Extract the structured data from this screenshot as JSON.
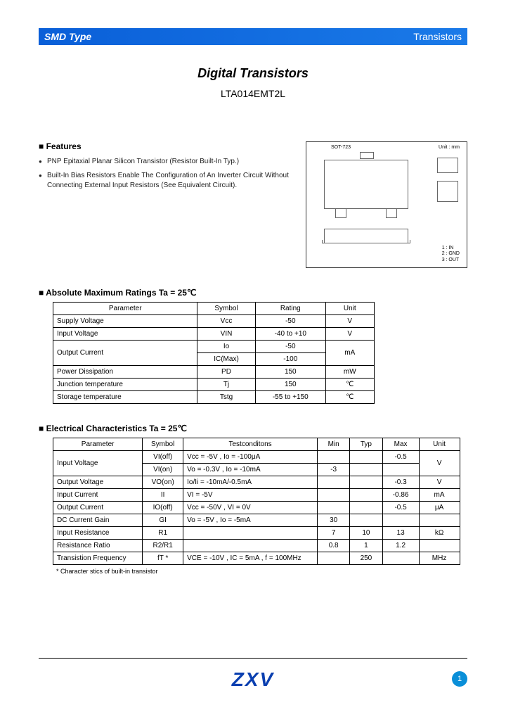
{
  "header": {
    "left": "SMD Type",
    "right": "Transistors"
  },
  "title": "Digital Transistors",
  "part_number": "LTA014EMT2L",
  "features": {
    "heading": "Features",
    "items": [
      "PNP Epitaxial Planar Silicon Transistor (Resistor Built-In Typ.)",
      "Built-In Bias Resistors Enable The Configuration of An Inverter Circuit Without Connecting External Input Resistors (See Equivalent Circuit)."
    ]
  },
  "diagram": {
    "pkg_label": "SOT-723",
    "unit_label": "Unit : mm",
    "pins": [
      "1 : IN",
      "2 : GND",
      "3 : OUT"
    ]
  },
  "abs_max": {
    "heading": "Absolute Maximum Ratings Ta = 25℃",
    "headers": [
      "Parameter",
      "Symbol",
      "Rating",
      "Unit"
    ],
    "rows": [
      {
        "p": "Supply Voltage",
        "s": "Vcc",
        "r": "-50",
        "u": "V"
      },
      {
        "p": "Input Voltage",
        "s": "VIN",
        "r": "-40 to +10",
        "u": "V"
      },
      {
        "p": "Output Current",
        "s": "Io",
        "r": "-50",
        "u": "mA",
        "rowspan_p": 2,
        "rowspan_u": 2
      },
      {
        "p": "",
        "s": "IC(Max)",
        "r": "-100",
        "u": ""
      },
      {
        "p": "Power Dissipation",
        "s": "PD",
        "r": "150",
        "u": "mW"
      },
      {
        "p": "Junction temperature",
        "s": "Tj",
        "r": "150",
        "u": "℃"
      },
      {
        "p": "Storage temperature",
        "s": "Tstg",
        "r": "-55 to +150",
        "u": "℃"
      }
    ]
  },
  "elec": {
    "heading": "Electrical Characteristics Ta = 25℃",
    "headers": [
      "Parameter",
      "Symbol",
      "Testconditons",
      "Min",
      "Typ",
      "Max",
      "Unit"
    ],
    "rows": [
      {
        "p": "Input Voltage",
        "s": "VI(off)",
        "t": "Vcc = -5V , Io = -100μA",
        "min": "",
        "typ": "",
        "max": "-0.5",
        "u": "V",
        "rowspan_p": 2,
        "rowspan_u": 2
      },
      {
        "p": "",
        "s": "VI(on)",
        "t": "Vo = -0.3V , Io = -10mA",
        "min": "-3",
        "typ": "",
        "max": "",
        "u": ""
      },
      {
        "p": "Output Voltage",
        "s": "VO(on)",
        "t": "Io/Ii = -10mA/-0.5mA",
        "min": "",
        "typ": "",
        "max": "-0.3",
        "u": "V"
      },
      {
        "p": "Input Current",
        "s": "II",
        "t": "VI = -5V",
        "min": "",
        "typ": "",
        "max": "-0.86",
        "u": "mA"
      },
      {
        "p": "Output Current",
        "s": "IO(off)",
        "t": "Vcc = -50V , VI = 0V",
        "min": "",
        "typ": "",
        "max": "-0.5",
        "u": "μA"
      },
      {
        "p": "DC Current Gain",
        "s": "GI",
        "t": "Vo = -5V , Io = -5mA",
        "min": "30",
        "typ": "",
        "max": "",
        "u": ""
      },
      {
        "p": "Input Resistance",
        "s": "R1",
        "t": "",
        "min": "7",
        "typ": "10",
        "max": "13",
        "u": "kΩ"
      },
      {
        "p": "Resistance Ratio",
        "s": "R2/R1",
        "t": "",
        "min": "0.8",
        "typ": "1",
        "max": "1.2",
        "u": ""
      },
      {
        "p": "Transistion Frequency",
        "s": "fT *",
        "t": "VCE = -10V , IC = 5mA , f = 100MHz",
        "min": "",
        "typ": "250",
        "max": "",
        "u": "MHz"
      }
    ],
    "footnote": "* Character stics of built-in transistor"
  },
  "footer": {
    "logo": "ZXV",
    "page": "1"
  }
}
